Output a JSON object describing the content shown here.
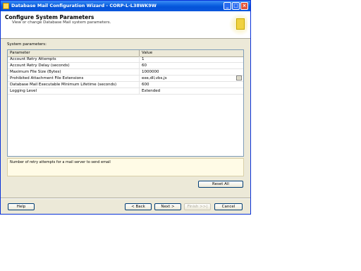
{
  "window": {
    "title": "Database Mail Configuration Wizard - CORP-L-L38WK9W",
    "minimize_glyph": "_",
    "maximize_glyph": "□",
    "close_glyph": "×"
  },
  "header": {
    "title": "Configure System Parameters",
    "subtitle": "View or change Database Mail system parameters."
  },
  "grid": {
    "section_label": "System parameters:",
    "columns": [
      "Parameter",
      "Value"
    ],
    "rows": [
      {
        "parameter": "Account Retry Attempts",
        "value": "1"
      },
      {
        "parameter": "Account Retry Delay (seconds)",
        "value": "60"
      },
      {
        "parameter": "Maximum File Size (Bytes)",
        "value": "1000000"
      },
      {
        "parameter": "Prohibited Attachment File Extensions",
        "value": "exe,dll,vbs,js"
      },
      {
        "parameter": "Database Mail Executable Minimum Lifetime (seconds)",
        "value": "600"
      },
      {
        "parameter": "Logging Level",
        "value": "Extended"
      }
    ],
    "ellipsis_label": "..."
  },
  "description": "Number of retry attempts for a mail server to send email",
  "buttons": {
    "reset_all": "Reset All",
    "help": "Help",
    "back": "< Back",
    "next": "Next >",
    "finish": "Finish >>|",
    "cancel": "Cancel"
  }
}
